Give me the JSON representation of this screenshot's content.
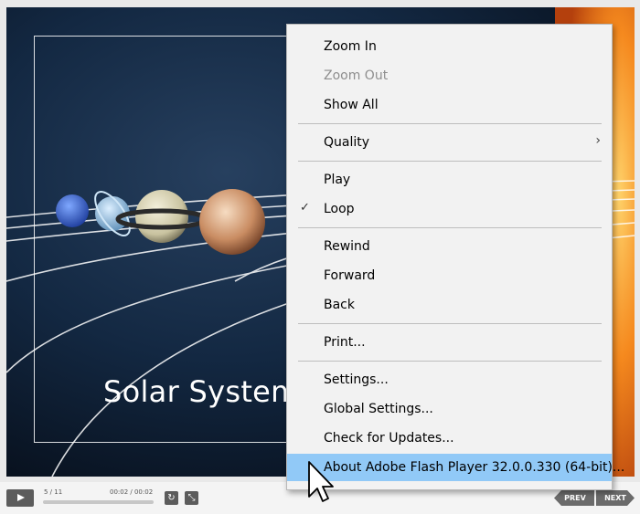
{
  "slide": {
    "title": "Solar System"
  },
  "player": {
    "slide_counter": "5 / 11",
    "time": "00:02 / 00:02",
    "prev_label": "PREV",
    "next_label": "NEXT"
  },
  "context_menu": {
    "items": [
      {
        "label": "Zoom In"
      },
      {
        "label": "Zoom Out",
        "disabled": true
      },
      {
        "label": "Show All"
      },
      {
        "label": "Quality",
        "submenu": true
      },
      {
        "label": "Play"
      },
      {
        "label": "Loop",
        "checked": true
      },
      {
        "label": "Rewind"
      },
      {
        "label": "Forward"
      },
      {
        "label": "Back"
      },
      {
        "label": "Print..."
      },
      {
        "label": "Settings..."
      },
      {
        "label": "Global Settings..."
      },
      {
        "label": "Check for Updates..."
      },
      {
        "label": "About Adobe Flash Player 32.0.0.330 (64-bit)...",
        "highlighted": true
      }
    ]
  },
  "colors": {
    "highlight": "#91c9f7",
    "menu_bg": "#f2f2f2",
    "disabled_text": "#8e8e8e"
  }
}
